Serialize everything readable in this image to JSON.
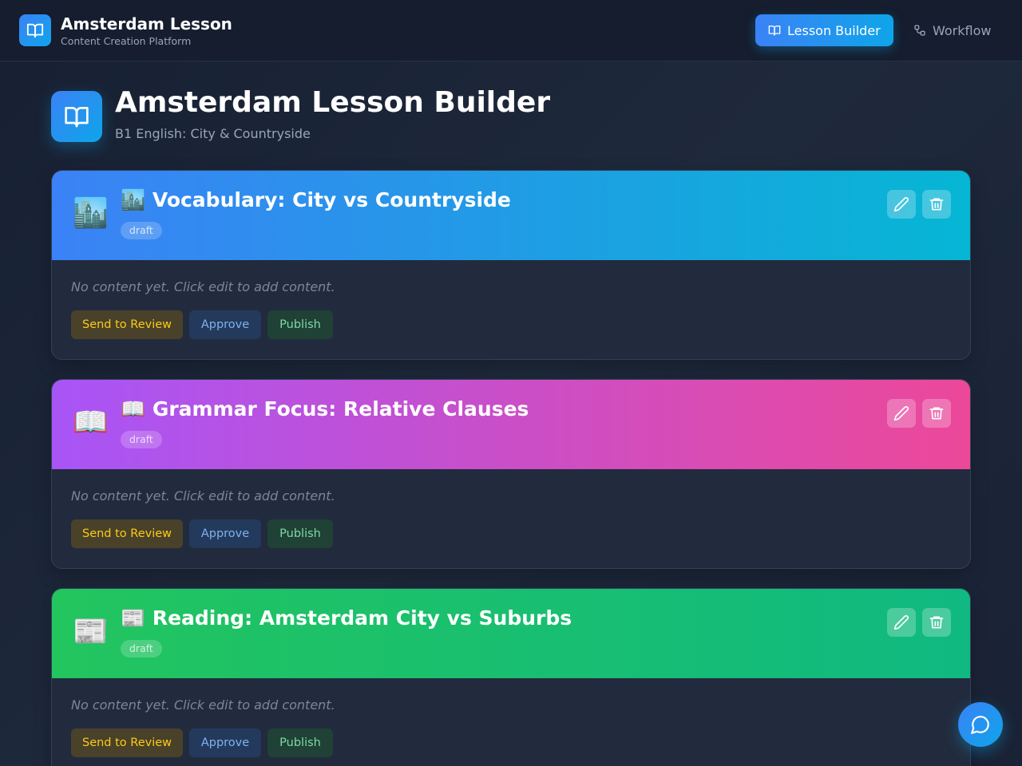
{
  "header": {
    "title": "Amsterdam Lesson",
    "subtitle": "Content Creation Platform",
    "nav": [
      {
        "label": "Lesson Builder",
        "icon": "book-open-icon",
        "active": true
      },
      {
        "label": "Workflow",
        "icon": "workflow-icon",
        "active": false
      }
    ]
  },
  "page": {
    "title": "Amsterdam Lesson Builder",
    "subtitle": "B1 English: City & Countryside"
  },
  "sections": [
    {
      "emoji": "🏙️",
      "title": "🏙️ Vocabulary: City vs Countryside",
      "status": "draft",
      "empty_text": "No content yet. Click edit to add content.",
      "color_from": "#3b82f6",
      "color_to": "#06b6d4"
    },
    {
      "emoji": "📖",
      "title": "📖 Grammar Focus: Relative Clauses",
      "status": "draft",
      "empty_text": "No content yet. Click edit to add content.",
      "color_from": "#a855f7",
      "color_to": "#ec4899"
    },
    {
      "emoji": "📰",
      "title": "📰 Reading: Amsterdam City vs Suburbs",
      "status": "draft",
      "empty_text": "No content yet. Click edit to add content.",
      "color_from": "#22c55e",
      "color_to": "#10b981"
    }
  ],
  "actions": {
    "review_label": "Send to Review",
    "approve_label": "Approve",
    "publish_label": "Publish"
  },
  "icons": {
    "edit": "pencil-icon",
    "delete": "trash-icon",
    "chat": "chat-bubble-icon"
  }
}
